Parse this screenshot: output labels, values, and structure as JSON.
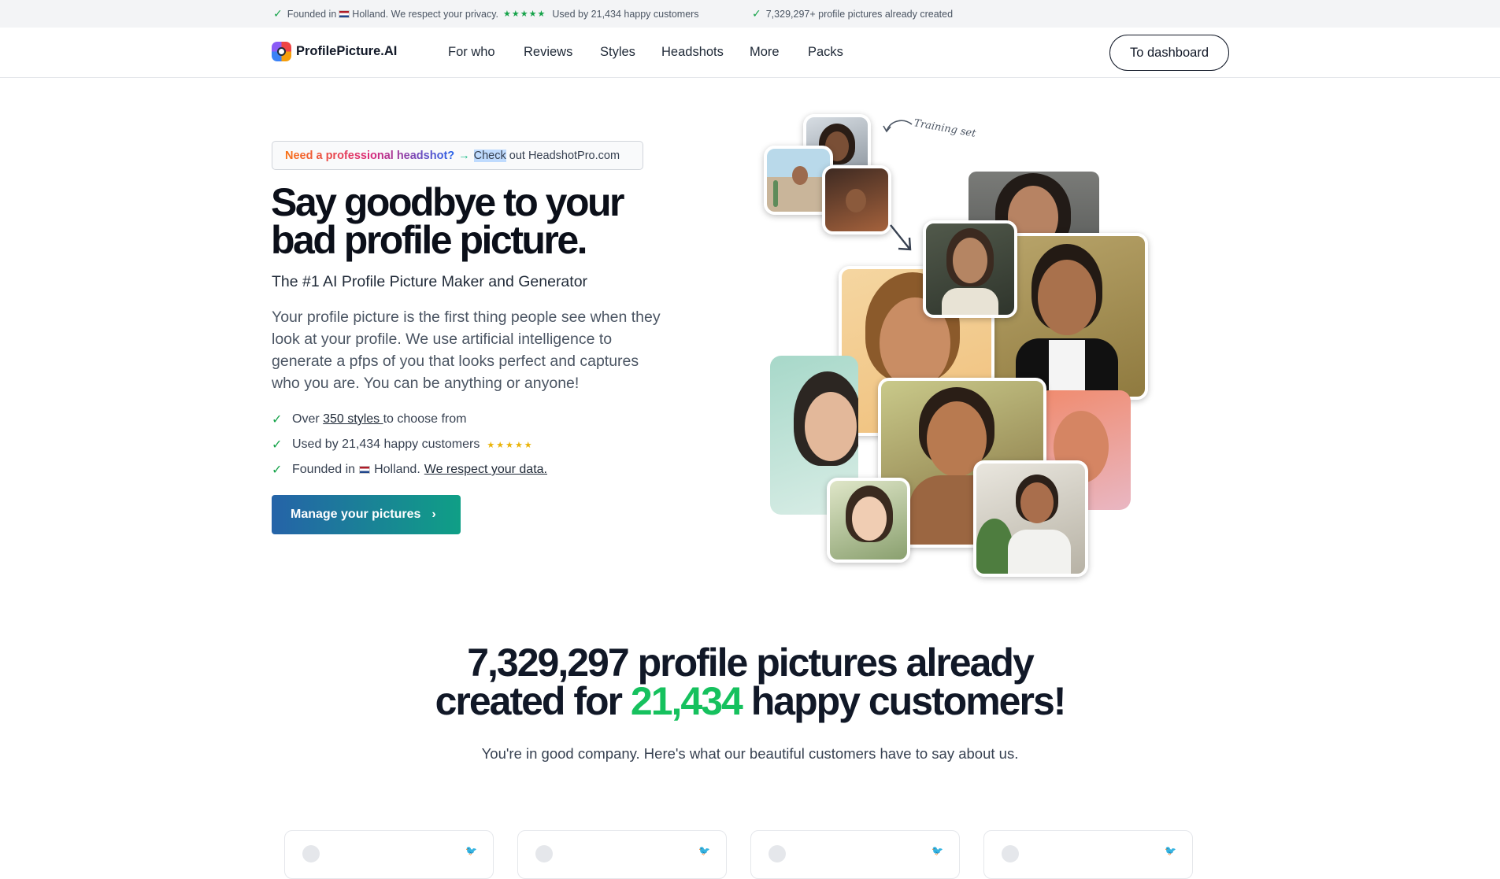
{
  "topbar": {
    "item1_a": "Founded in",
    "item1_b": "Holland. We respect your privacy.",
    "item1_stars": "★★★★★",
    "item1_c": "Used by 21,434 happy customers",
    "item2": "7,329,297+ profile pictures already created"
  },
  "nav": {
    "logo": "ProfilePicture.AI",
    "links": [
      "For who",
      "Reviews",
      "Styles",
      "Headshots",
      "More",
      "Packs"
    ],
    "dashboard": "To dashboard"
  },
  "promo": {
    "highlight": "Need a professional headshot?",
    "arrow": "→",
    "selected": "Check",
    "rest": " out HeadshotPro.com"
  },
  "hero": {
    "title": "Say goodbye to your bad profile picture.",
    "subtitle": "The #1 AI Profile Picture Maker and Generator",
    "description": "Your profile picture is the first thing people see when they look at your profile. We use artificial intelligence to generate a pfps of you that looks perfect and captures who you are. You can be anything or anyone!",
    "check1_a": "Over ",
    "check1_link": "350 styles ",
    "check1_b": "to choose from",
    "check2": "Used by 21,434 happy customers",
    "check2_stars": "★★★★★",
    "check3_a": "Founded in",
    "check3_b": "Holland.",
    "check3_link": "We respect your data.",
    "cta": "Manage your pictures",
    "cta_chevron": "›"
  },
  "collage": {
    "training_label": "Training set"
  },
  "stats": {
    "count": "7,329,297",
    "text1": " profile pictures already",
    "text2": "created for ",
    "customers": "21,434",
    "text3": " happy customers!",
    "subtitle": "You're in good company. Here's what our beautiful customers have to say about us."
  },
  "colors": {
    "accent_green": "#16c15e",
    "cta_start": "#2563a8",
    "cta_end": "#0f9f86"
  }
}
